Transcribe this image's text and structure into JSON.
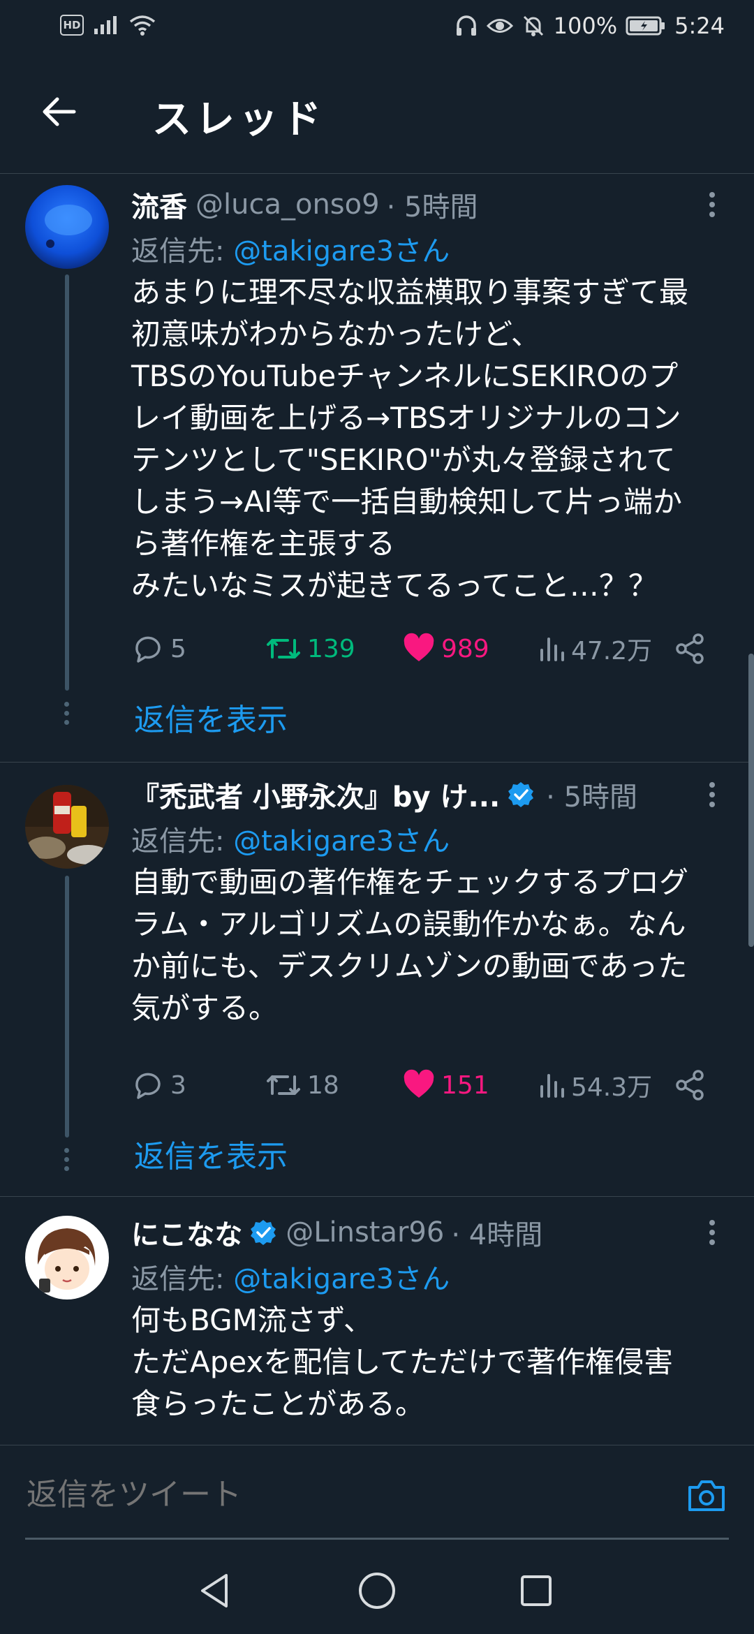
{
  "status_bar": {
    "hd": "HD",
    "battery": "100%",
    "time": "5:24",
    "icons": [
      "signal-icon",
      "wifi-icon",
      "headphones-icon",
      "eye-icon",
      "mute-bell-icon",
      "battery-icon"
    ]
  },
  "header": {
    "title": "スレッド"
  },
  "tweets": [
    {
      "name": "流香",
      "handle": "@luca_onso9",
      "time": "· 5時間",
      "reply_prefix": "返信先: ",
      "reply_to": "@takigare3さん",
      "lines": [
        "あまりに理不尽な収益横取り事案すぎて最",
        "初意味がわからなかったけど、",
        "TBSのYouTubeチャンネルにSEKIROのプ",
        "レイ動画を上げる→TBSオリジナルのコン",
        "テンツとして\"SEKIRO\"が丸々登録されて",
        "しまう→AI等で一括自動検知して片っ端か",
        "ら著作権を主張する",
        "みたいなミスが起きてるってこと…？？"
      ],
      "replies": "5",
      "retweets": "139",
      "likes": "989",
      "views": "47.2万",
      "show_replies": "返信を表示"
    },
    {
      "name": "『禿武者 小野永次』by け...",
      "handle": "",
      "time": "· 5時間",
      "reply_prefix": "返信先: ",
      "reply_to": "@takigare3さん",
      "lines": [
        "自動で動画の著作権をチェックするプログ",
        "ラム・アルゴリズムの誤動作かなぁ。なん",
        "か前にも、デスクリムゾンの動画であった",
        "気がする。"
      ],
      "replies": "3",
      "retweets": "18",
      "likes": "151",
      "views": "54.3万",
      "show_replies": "返信を表示"
    },
    {
      "name": "にこなな",
      "handle": "@Linstar96",
      "time": "· 4時間",
      "reply_prefix": "返信先: ",
      "reply_to": "@takigare3さん",
      "lines": [
        "何もBGM流さず、",
        "ただApexを配信してただけで著作権侵害",
        "食らったことがある。"
      ]
    }
  ],
  "composer": {
    "placeholder": "返信をツイート"
  },
  "colors": {
    "background": "#15202b",
    "accent": "#1d9bf0",
    "retweet_active": "#00ba7c",
    "like_active": "#f91880",
    "muted": "#8b98a5"
  }
}
